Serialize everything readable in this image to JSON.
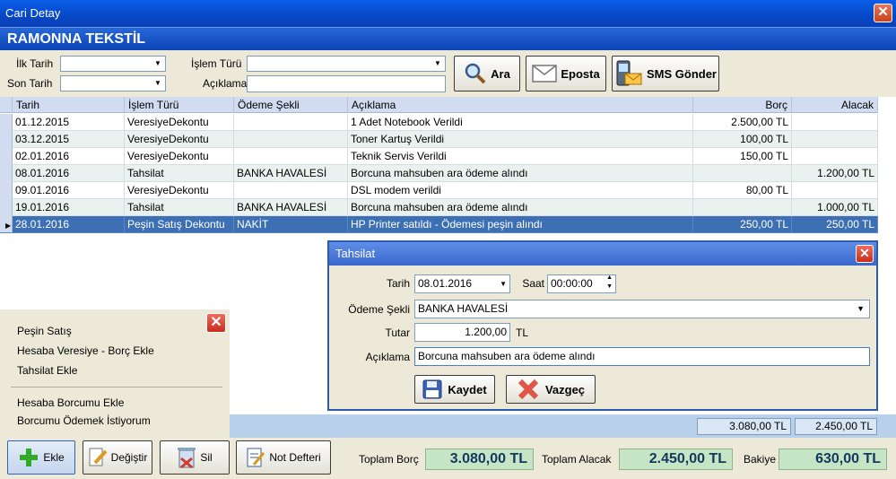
{
  "window": {
    "title": "Cari Detay"
  },
  "customer": {
    "name": "RAMONNA TEKSTİL"
  },
  "filters": {
    "first_date_label": "İlk Tarih",
    "last_date_label": "Son Tarih",
    "type_label": "İşlem Türü",
    "desc_label": "Açıklama"
  },
  "toolbar": {
    "search": "Ara",
    "email": "Eposta",
    "sms": "SMS Gönder"
  },
  "table": {
    "columns": [
      "Tarih",
      "İşlem Türü",
      "Ödeme Şekli",
      "Açıklama",
      "Borç",
      "Alacak"
    ],
    "rows": [
      {
        "date": "01.12.2015",
        "type": "VeresiyeDekontu",
        "pay": "",
        "desc": "1 Adet Notebook Verildi",
        "debit": "2.500,00 TL",
        "credit": ""
      },
      {
        "date": "03.12.2015",
        "type": "VeresiyeDekontu",
        "pay": "",
        "desc": "Toner Kartuş Verildi",
        "debit": "100,00 TL",
        "credit": ""
      },
      {
        "date": "02.01.2016",
        "type": "VeresiyeDekontu",
        "pay": "",
        "desc": "Teknik Servis Verildi",
        "debit": "150,00 TL",
        "credit": ""
      },
      {
        "date": "08.01.2016",
        "type": "Tahsilat",
        "pay": "BANKA HAVALESİ",
        "desc": "Borcuna mahsuben ara ödeme alındı",
        "debit": "",
        "credit": "1.200,00 TL"
      },
      {
        "date": "09.01.2016",
        "type": "VeresiyeDekontu",
        "pay": "",
        "desc": "DSL modem verildi",
        "debit": "80,00 TL",
        "credit": ""
      },
      {
        "date": "19.01.2016",
        "type": "Tahsilat",
        "pay": "BANKA HAVALESİ",
        "desc": "Borcuna mahsuben ara ödeme alındı",
        "debit": "",
        "credit": "1.000,00 TL"
      },
      {
        "date": "28.01.2016",
        "type": "Peşin Satış Dekontu",
        "pay": "NAKİT",
        "desc": "HP Printer satıldı - Ödemesi peşin alındı",
        "debit": "250,00 TL",
        "credit": "250,00 TL"
      }
    ],
    "sum_debit": "3.080,00 TL",
    "sum_credit": "2.450,00 TL"
  },
  "popup_menu": {
    "items": [
      "Peşin Satış",
      "Hesaba Veresiye - Borç Ekle",
      "Tahsilat Ekle"
    ],
    "items2": [
      "Hesaba Borcumu Ekle",
      "Borcumu Ödemek İstiyorum"
    ]
  },
  "dialog": {
    "title": "Tahsilat",
    "date_label": "Tarih",
    "date_value": "08.01.2016",
    "time_label": "Saat",
    "time_value": "00:00:00",
    "pay_label": "Ödeme Şekli",
    "pay_value": "BANKA HAVALESİ",
    "amount_label": "Tutar",
    "amount_value": "1.200,00",
    "amount_unit": "TL",
    "desc_label": "Açıklama",
    "desc_value": "Borcuna mahsuben ara ödeme alındı",
    "save": "Kaydet",
    "cancel": "Vazgeç"
  },
  "bottom": {
    "add": "Ekle",
    "edit": "Değiştir",
    "delete": "Sil",
    "notes": "Not Defteri",
    "total_debit_label": "Toplam Borç",
    "total_debit": "3.080,00 TL",
    "total_credit_label": "Toplam Alacak",
    "total_credit": "2.450,00 TL",
    "balance_label": "Bakiye",
    "balance": "630,00 TL"
  }
}
